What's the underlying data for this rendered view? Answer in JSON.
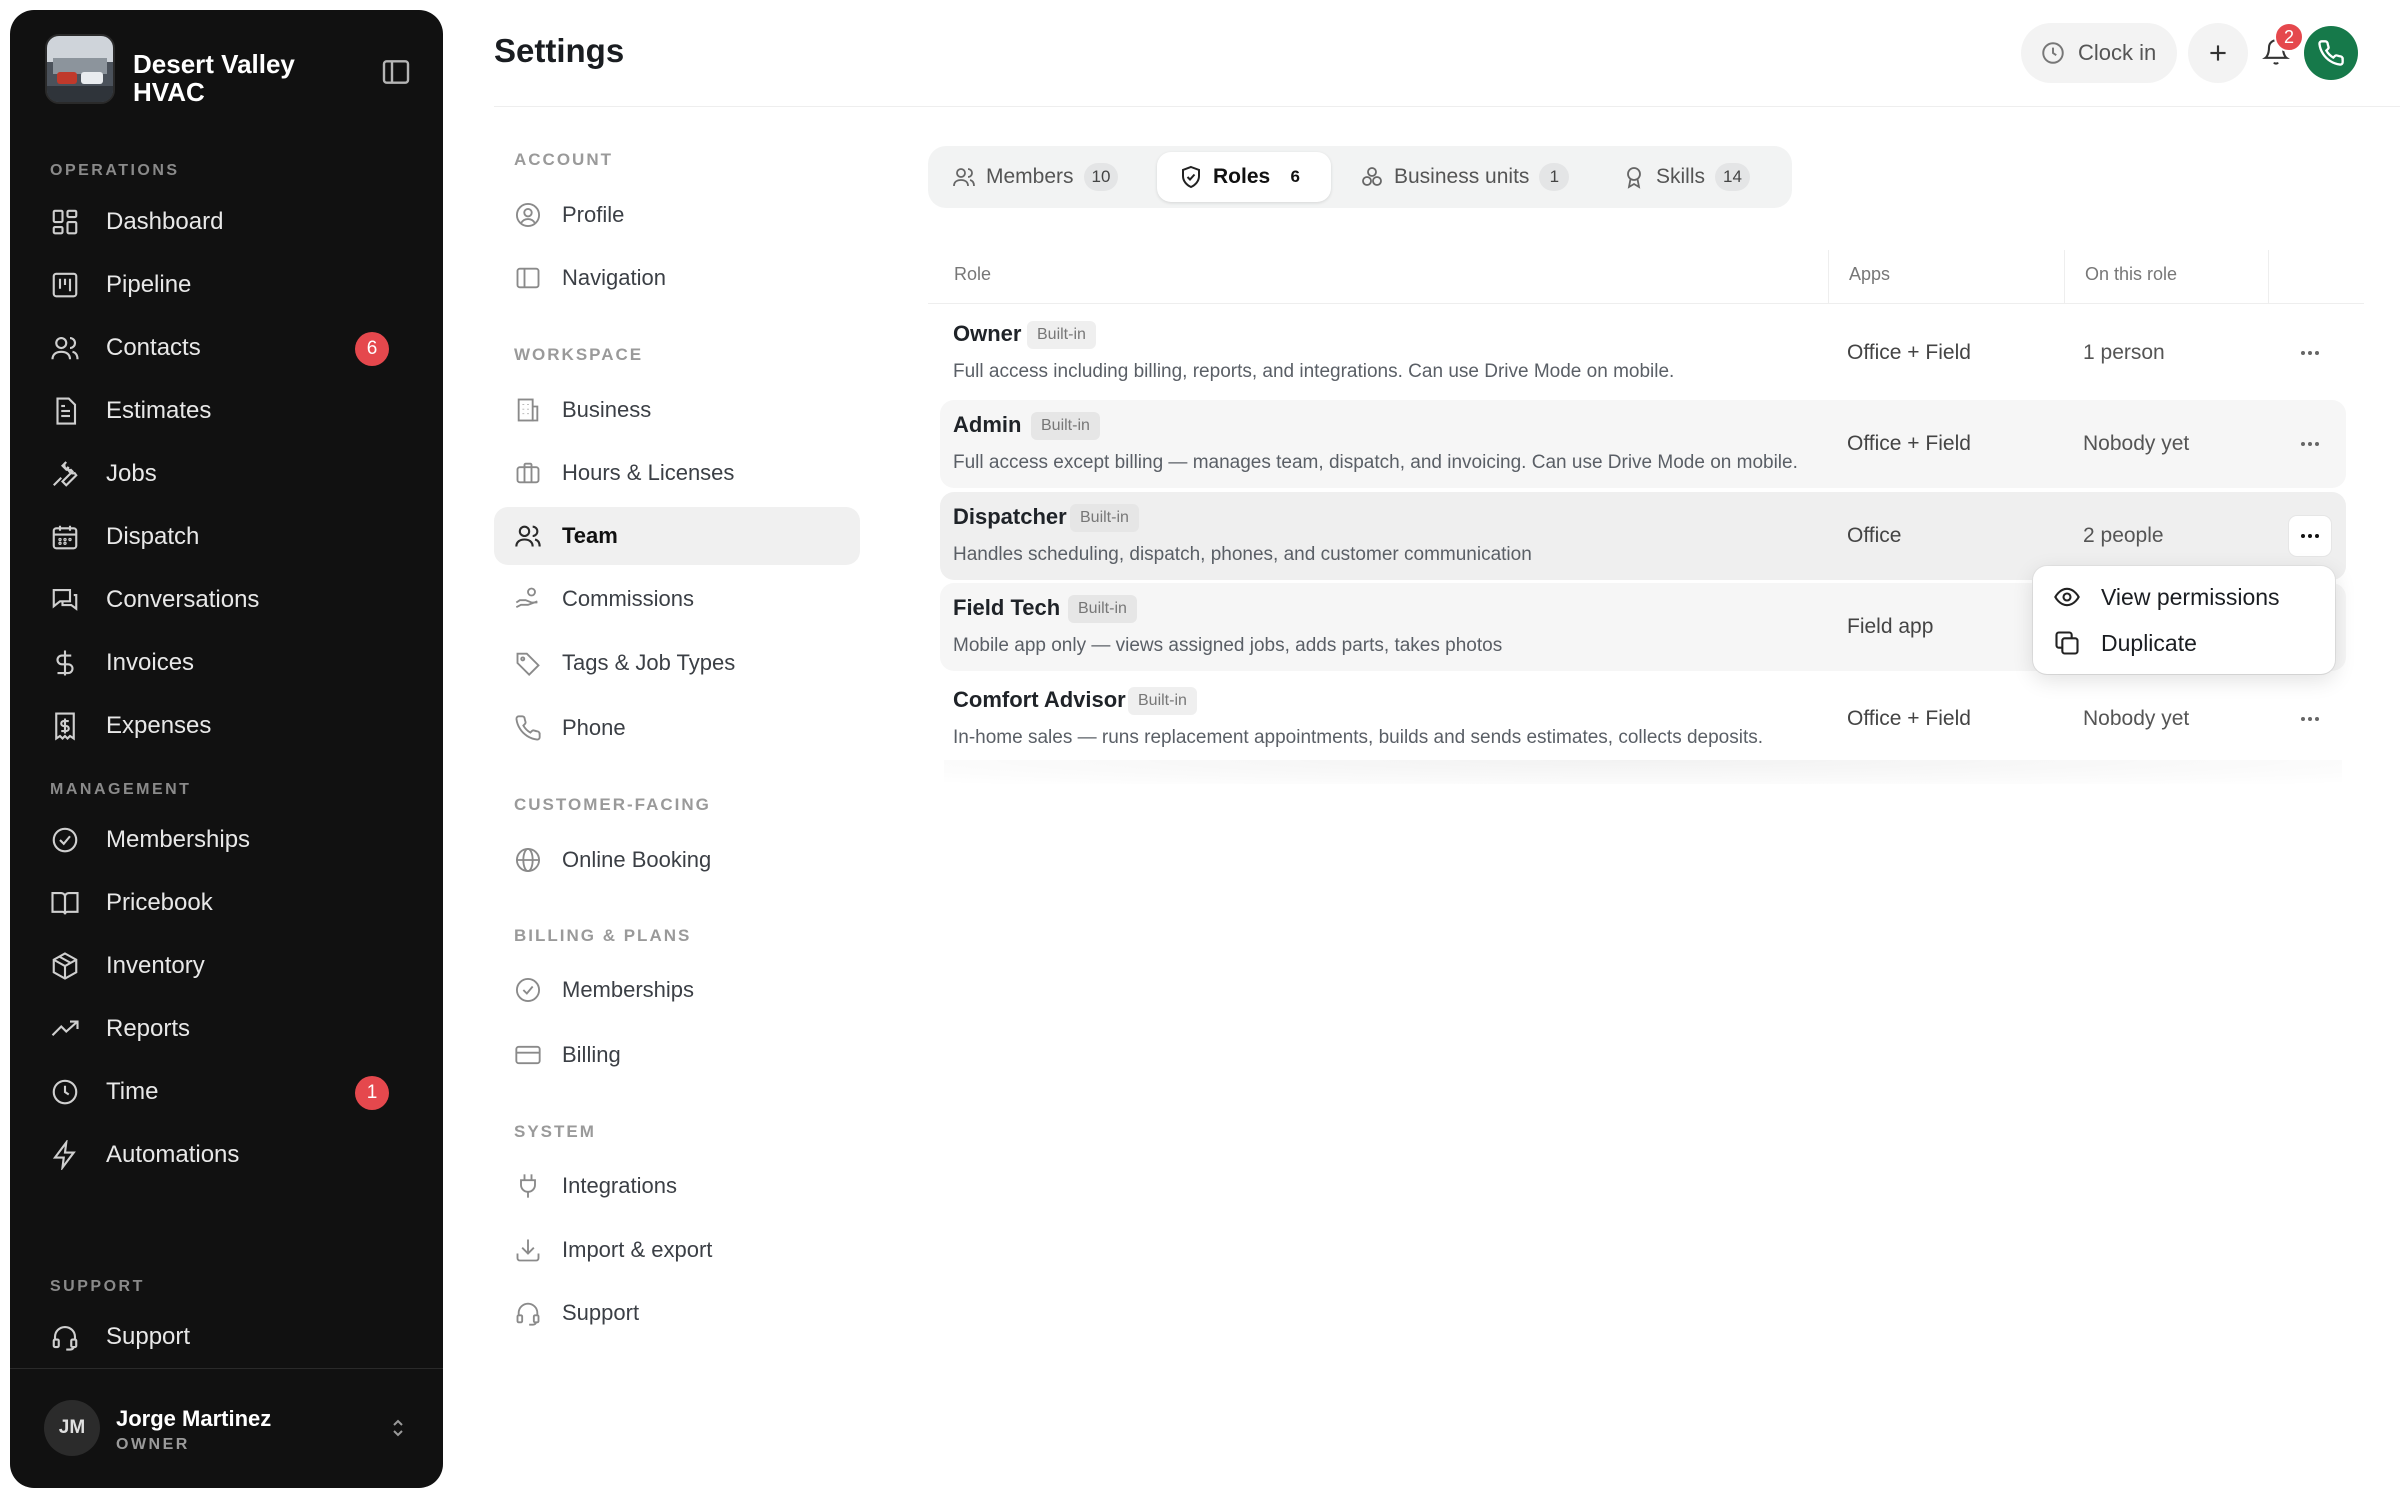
{
  "brand": {
    "name": "Desert Valley HVAC"
  },
  "sidebar": {
    "sections": {
      "operations": "OPERATIONS",
      "management": "MANAGEMENT",
      "support": "SUPPORT"
    },
    "operations": [
      {
        "label": "Dashboard",
        "icon": "dashboard-icon"
      },
      {
        "label": "Pipeline",
        "icon": "pipeline-icon"
      },
      {
        "label": "Contacts",
        "icon": "users-icon",
        "badge": "6"
      },
      {
        "label": "Estimates",
        "icon": "document-icon"
      },
      {
        "label": "Jobs",
        "icon": "wrench-icon"
      },
      {
        "label": "Dispatch",
        "icon": "calendar-icon"
      },
      {
        "label": "Conversations",
        "icon": "chat-icon"
      },
      {
        "label": "Invoices",
        "icon": "dollar-icon"
      },
      {
        "label": "Expenses",
        "icon": "receipt-icon"
      }
    ],
    "management": [
      {
        "label": "Memberships",
        "icon": "check-circle-icon"
      },
      {
        "label": "Pricebook",
        "icon": "book-icon"
      },
      {
        "label": "Inventory",
        "icon": "box-icon"
      },
      {
        "label": "Reports",
        "icon": "trend-icon"
      },
      {
        "label": "Time",
        "icon": "clock-icon",
        "badge": "1"
      },
      {
        "label": "Automations",
        "icon": "bolt-icon"
      }
    ],
    "support": [
      {
        "label": "Support",
        "icon": "headset-icon"
      }
    ],
    "user": {
      "initials": "JM",
      "name": "Jorge Martinez",
      "role": "OWNER"
    }
  },
  "header": {
    "title": "Settings",
    "clock_label": "Clock in",
    "notifications_count": "2"
  },
  "settings_nav": {
    "account_label": "ACCOUNT",
    "account": [
      {
        "label": "Profile"
      },
      {
        "label": "Navigation"
      }
    ],
    "workspace_label": "WORKSPACE",
    "workspace": [
      {
        "label": "Business"
      },
      {
        "label": "Hours & Licenses"
      },
      {
        "label": "Team"
      },
      {
        "label": "Commissions"
      },
      {
        "label": "Tags & Job Types"
      },
      {
        "label": "Phone"
      }
    ],
    "customer_label": "CUSTOMER-FACING",
    "customer": [
      {
        "label": "Online Booking"
      }
    ],
    "billing_label": "BILLING & PLANS",
    "billing": [
      {
        "label": "Memberships"
      },
      {
        "label": "Billing"
      }
    ],
    "system_label": "SYSTEM",
    "system": [
      {
        "label": "Integrations"
      },
      {
        "label": "Import & export"
      },
      {
        "label": "Support"
      }
    ]
  },
  "tabs": [
    {
      "label": "Members",
      "count": "10"
    },
    {
      "label": "Roles",
      "count": "6",
      "active": true
    },
    {
      "label": "Business units",
      "count": "1"
    },
    {
      "label": "Skills",
      "count": "14"
    }
  ],
  "table": {
    "columns": [
      "Role",
      "Apps",
      "On this role"
    ],
    "rows": [
      {
        "name": "Owner",
        "badge": "Built-in",
        "desc": "Full access including billing, reports, and integrations. Can use Drive Mode on mobile.",
        "apps": "Office + Field",
        "people": "1 person"
      },
      {
        "name": "Admin",
        "badge": "Built-in",
        "desc": "Full access except billing — manages team, dispatch, and invoicing. Can use Drive Mode on mobile.",
        "apps": "Office + Field",
        "people": "Nobody yet"
      },
      {
        "name": "Dispatcher",
        "badge": "Built-in",
        "desc": "Handles scheduling, dispatch, phones, and customer communication",
        "apps": "Office",
        "people": "2 people"
      },
      {
        "name": "Field Tech",
        "badge": "Built-in",
        "desc": "Mobile app only — views assigned jobs, adds parts, takes photos",
        "apps": "Field app",
        "people": ""
      },
      {
        "name": "Comfort Advisor",
        "badge": "Built-in",
        "desc": "In-home sales — runs replacement appointments, builds and sends estimates, collects deposits.",
        "apps": "Office + Field",
        "people": "Nobody yet"
      }
    ]
  },
  "row_menu": {
    "view_label": "View permissions",
    "duplicate_label": "Duplicate"
  },
  "colors": {
    "sidebar_bg": "#111111",
    "badge_red": "#e5484d",
    "phone_green": "#16794a"
  }
}
